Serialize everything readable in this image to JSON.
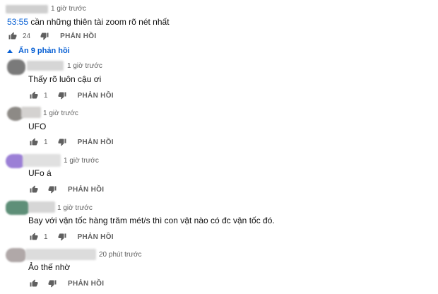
{
  "top_comment": {
    "time": "1 giờ trước",
    "timestamp_link": "53:55",
    "text": " cần những thiên tài zoom rõ nét nhất",
    "likes": "24",
    "reply_label": "PHẢN HỒI"
  },
  "replies_toggle": {
    "label": "Ẩn 9 phản hồi",
    "icon": "chevron-up-icon"
  },
  "replies": [
    {
      "time": "1 giờ trước",
      "text": "Thấy rõ luôn cậu ơi",
      "likes": "1",
      "reply_label": "PHẢN HỒI",
      "avatar_color": "#7a7a7a"
    },
    {
      "time": "1 giờ trước",
      "text": "UFO",
      "likes": "1",
      "reply_label": "PHẢN HỒI",
      "avatar_color": "#8d8a86"
    },
    {
      "time": "1 giờ trước",
      "text": "UFo á",
      "likes": "",
      "reply_label": "PHẢN HỒI",
      "avatar_color": "#9b7fd6"
    },
    {
      "time": "1 giờ trước",
      "text": "Bay với vận tốc hàng trăm mét/s thì con vật nào có đc vận tốc đó.",
      "likes": "1",
      "reply_label": "PHẢN HỒI",
      "avatar_color": "#5e8f78"
    },
    {
      "time": "20 phút trước",
      "text": "Ảo thế nhờ",
      "likes": "",
      "reply_label": "PHẢN HỒI",
      "avatar_color": "#b0a8a8"
    }
  ]
}
